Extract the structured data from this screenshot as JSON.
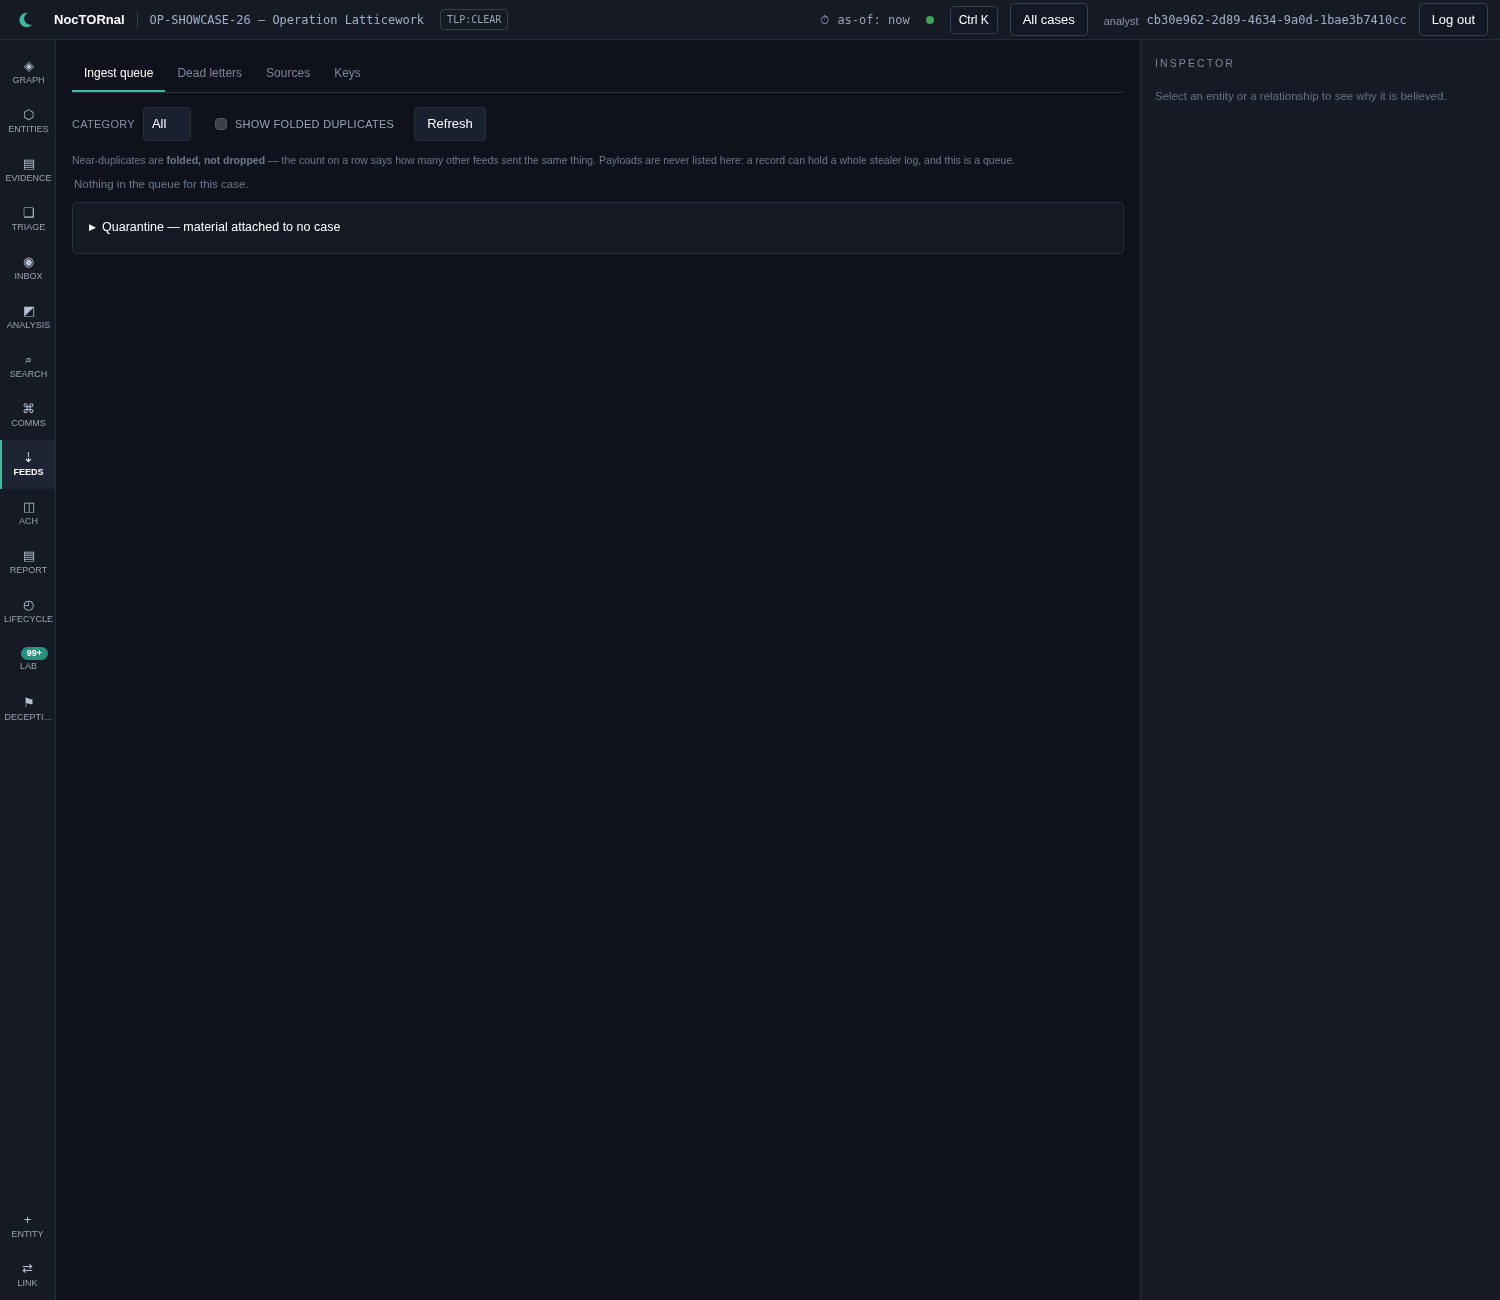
{
  "header": {
    "brand": "NocTORnal",
    "case": "OP-SHOWCASE-26 — Operation Latticework",
    "tlp": "TLP:CLEAR",
    "asof_glyph": "⏱",
    "asof": "as-of: now",
    "connected": true,
    "shortcut": "Ctrl K",
    "all_cases": "All cases",
    "analyst_label": "analyst",
    "analyst_id": "cb30e962-2d89-4634-9a0d-1bae3b7410cc",
    "logout": "Log out"
  },
  "nav": [
    {
      "glyph": "◈",
      "label": "GRAPH",
      "selected": false
    },
    {
      "glyph": "⬡",
      "label": "ENTITIES",
      "selected": false
    },
    {
      "glyph": "▤",
      "label": "EVIDENCE",
      "selected": false
    },
    {
      "glyph": "❏",
      "label": "TRIAGE",
      "selected": false
    },
    {
      "glyph": "◉",
      "label": "INBOX",
      "selected": false
    },
    {
      "glyph": "◩",
      "label": "ANALYSIS",
      "selected": false
    },
    {
      "glyph": "⌕",
      "label": "SEARCH",
      "selected": false
    },
    {
      "glyph": "⌘",
      "label": "COMMS",
      "selected": false
    },
    {
      "glyph": "⇣",
      "label": "FEEDS",
      "selected": true
    },
    {
      "glyph": "◫",
      "label": "ACH",
      "selected": false
    },
    {
      "glyph": "▤",
      "label": "REPORT",
      "selected": false
    },
    {
      "glyph": "◴",
      "label": "LIFECYCLE",
      "selected": false
    },
    {
      "badge": "99+",
      "label": "LAB",
      "selected": false
    },
    {
      "glyph": "⚑",
      "label": "DECEPTI…",
      "selected": false
    }
  ],
  "nav_bottom": [
    {
      "glyph": "+",
      "label": "ENTITY"
    },
    {
      "glyph": "⇄",
      "label": "LINK"
    }
  ],
  "tabs": [
    {
      "label": "Ingest queue",
      "selected": true
    },
    {
      "label": "Dead letters",
      "selected": false
    },
    {
      "label": "Sources",
      "selected": false
    },
    {
      "label": "Keys",
      "selected": false
    }
  ],
  "filters": {
    "category_label": "CATEGORY",
    "category_value": "All",
    "show_folded_label": "SHOW FOLDED DUPLICATES",
    "show_folded_checked": false,
    "refresh": "Refresh"
  },
  "note": "Near-duplicates are **folded, not dropped** — the count on a row says how many other feeds sent the same thing. Payloads are never listed here: a record can hold a whole stealer log, and this is a queue.",
  "empty": "Nothing in the queue for this case.",
  "quarantine": {
    "glyph": "▶",
    "label": "Quarantine — material attached to no case",
    "expanded": false
  },
  "inspector": {
    "title": "INSPECTOR",
    "hint": "Select an entity or a relationship to see why it is believed."
  }
}
